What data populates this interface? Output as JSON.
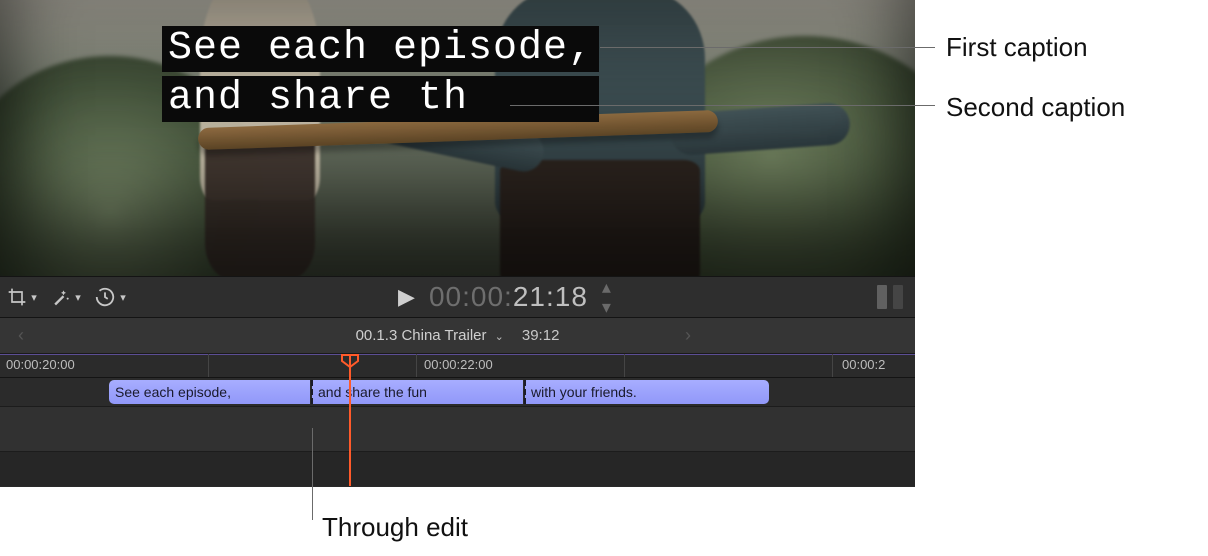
{
  "viewer": {
    "caption_line1": "See each episode,",
    "caption_line2": "and share th"
  },
  "toolbar": {
    "crop_icon": "crop-icon",
    "wand_icon": "wand-icon",
    "retime_icon": "retime-icon",
    "play_icon": "▶",
    "timecode_dim": "00:00:",
    "timecode_main": "21:18"
  },
  "project": {
    "name": "00.1.3 China Trailer",
    "duration": "39:12"
  },
  "ruler": {
    "marks": [
      "00:00:20:00",
      "00:00:22:00",
      "00:00:2"
    ]
  },
  "captions_track": {
    "clips": [
      {
        "text": "See each episode,"
      },
      {
        "text": "and share the fun"
      },
      {
        "text": "with your friends."
      }
    ]
  },
  "callouts": {
    "first": "First caption",
    "second": "Second caption",
    "through": "Through edit"
  }
}
